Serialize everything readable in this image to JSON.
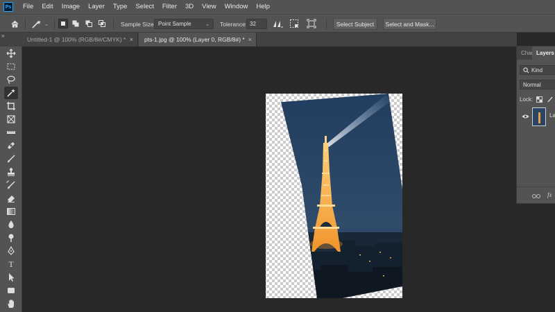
{
  "menubar": {
    "logo_text": "Ps",
    "items": [
      "File",
      "Edit",
      "Image",
      "Layer",
      "Type",
      "Select",
      "Filter",
      "3D",
      "View",
      "Window",
      "Help"
    ]
  },
  "options": {
    "sample_size_label": "Sample Size:",
    "sample_size_value": "Point Sample",
    "tolerance_label": "Tolerance:",
    "tolerance_value": "32",
    "select_subject_label": "Select Subject",
    "select_mask_label": "Select and Mask..."
  },
  "tabs": [
    {
      "title": "Untitled-1 @ 100% (RGB/8#/CMYK) *",
      "close": "×"
    },
    {
      "title": "pts-1.jpg @ 100% (Layer 0, RGB/8#) *",
      "close": "×"
    }
  ],
  "tabbar": {
    "collapse_glyph": "»"
  },
  "panel": {
    "tab_channels": "Char",
    "tab_layers": "Layers",
    "kind_label": "Kind",
    "blend_mode": "Normal",
    "lock_label": "Lock:",
    "layer_name": "La",
    "fx_label": "fx"
  },
  "toolbar": {
    "tools": [
      "move-tool",
      "marquee-tool",
      "lasso-tool",
      "magic-wand-tool",
      "crop-tool",
      "frame-tool",
      "ruler-tool",
      "healing-tool",
      "brush-tool",
      "stamp-tool",
      "history-brush-tool",
      "eraser-tool",
      "gradient-tool",
      "blur-tool",
      "dodge-tool",
      "pen-tool",
      "type-tool",
      "path-select-tool",
      "shape-tool",
      "hand-tool"
    ],
    "active_tool": "magic-wand-tool",
    "type_glyph": "T"
  },
  "colors": {
    "ui_bg": "#535353",
    "workspace_bg": "#282828",
    "accent": "#31a8ff"
  }
}
